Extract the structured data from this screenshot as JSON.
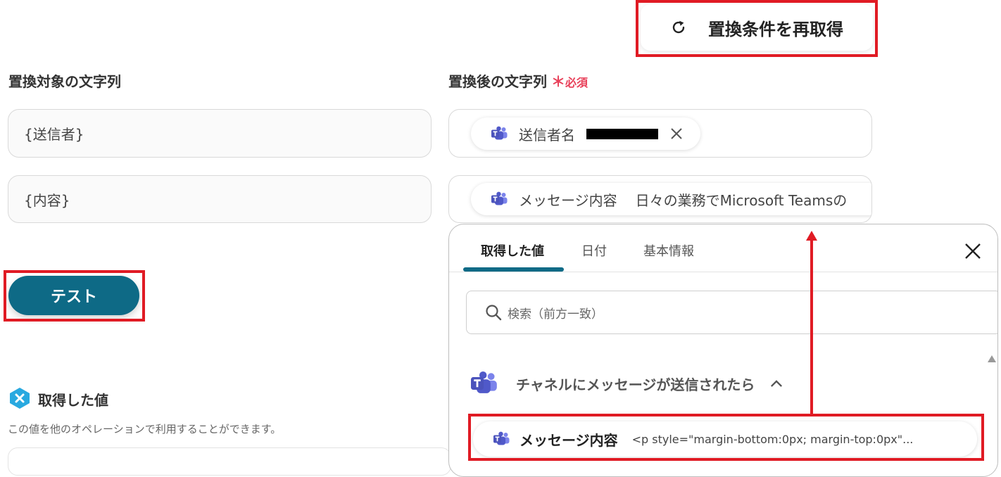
{
  "toolbar": {
    "refresh_label": "置換条件を再取得"
  },
  "replace_target": {
    "label": "置換対象の文字列",
    "rows": [
      {
        "value": "{送信者}"
      },
      {
        "value": "{内容}"
      }
    ]
  },
  "replace_after": {
    "label": "置換後の文字列",
    "required_mark": "＊",
    "required_label": "必須",
    "chips": [
      {
        "label": "送信者名"
      },
      {
        "label": "メッセージ内容",
        "preview": "日々の業務でMicrosoft Teamsの"
      }
    ]
  },
  "test_button": {
    "label": "テスト"
  },
  "obtained_values": {
    "title": "取得した値",
    "description": "この値を他のオペレーションで利用することができます。"
  },
  "picker": {
    "tabs": [
      {
        "label": "取得した値",
        "active": true
      },
      {
        "label": "日付",
        "active": false
      },
      {
        "label": "基本情報",
        "active": false
      }
    ],
    "search_placeholder": "検索（前方一致）",
    "group": {
      "title": "チャネルにメッセージが送信されたら",
      "expanded": true
    },
    "items": [
      {
        "label": "メッセージ内容",
        "preview": "<p style=\"margin-bottom:0px; margin-top:0px\"..."
      }
    ]
  },
  "colors": {
    "accent": "#0e6a86",
    "highlight": "#e01b24",
    "required": "#e8415a",
    "teams": "#5059c9"
  },
  "icons": {
    "refresh": "refresh-icon",
    "teams": "teams-icon",
    "close": "close-icon",
    "search": "search-icon",
    "chevron": "chevron-up-icon",
    "obtained": "variable-icon"
  }
}
